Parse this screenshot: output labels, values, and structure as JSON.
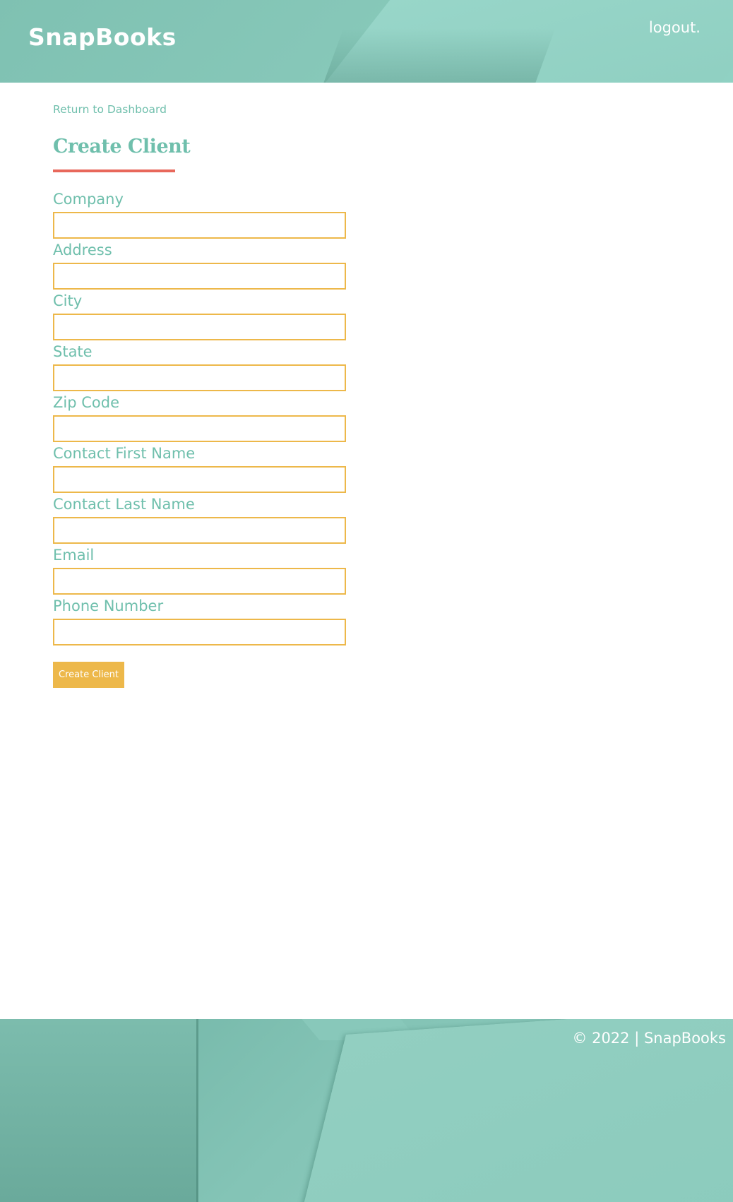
{
  "header": {
    "brand": "SnapBooks",
    "logout_label": "logout."
  },
  "nav": {
    "back_link_label": "Return to Dashboard"
  },
  "page": {
    "title": "Create Client"
  },
  "form": {
    "fields": [
      {
        "label": "Company",
        "value": ""
      },
      {
        "label": "Address",
        "value": ""
      },
      {
        "label": "City",
        "value": ""
      },
      {
        "label": "State",
        "value": ""
      },
      {
        "label": "Zip Code",
        "value": ""
      },
      {
        "label": "Contact First Name",
        "value": ""
      },
      {
        "label": "Contact Last Name",
        "value": ""
      },
      {
        "label": "Email",
        "value": ""
      },
      {
        "label": "Phone Number",
        "value": ""
      }
    ],
    "submit_label": "Create Client"
  },
  "footer": {
    "copyright": "© 2022 | SnapBooks"
  },
  "colors": {
    "teal": "#6fbfac",
    "header_teal": "#86c7b8",
    "accent_yellow": "#edb84a",
    "underline_red": "#e8685b"
  }
}
